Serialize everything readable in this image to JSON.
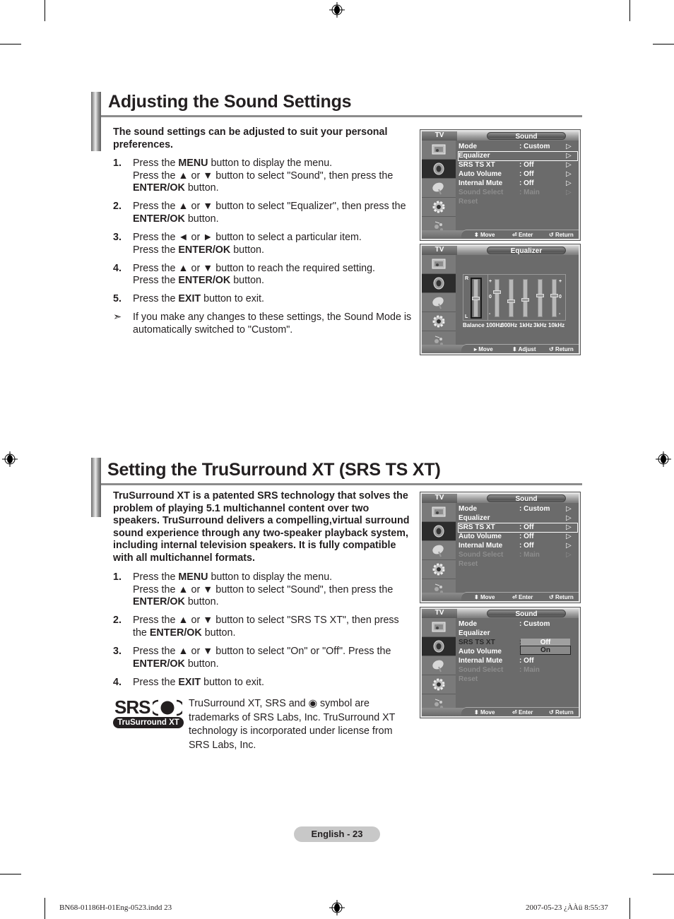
{
  "section1": {
    "title": "Adjusting the Sound Settings",
    "intro": "The sound settings can be adjusted to suit your personal preferences.",
    "steps": [
      {
        "num": "1.",
        "parts": [
          [
            "",
            "Press the "
          ],
          [
            "b",
            "MENU"
          ],
          [
            "",
            " button to display the menu."
          ],
          [
            "br",
            ""
          ],
          [
            "",
            "Press the ▲ or ▼ button to select \"Sound\", then press the "
          ],
          [
            "b",
            "ENTER/OK"
          ],
          [
            "",
            " button."
          ]
        ]
      },
      {
        "num": "2.",
        "parts": [
          [
            "",
            "Press the ▲ or ▼ button to select \"Equalizer\", then press the "
          ],
          [
            "b",
            "ENTER/OK"
          ],
          [
            "",
            " button."
          ]
        ]
      },
      {
        "num": "3.",
        "parts": [
          [
            "",
            "Press the ◄ or ► button to select a particular item."
          ],
          [
            "br",
            ""
          ],
          [
            "",
            "Press the "
          ],
          [
            "b",
            "ENTER/OK"
          ],
          [
            "",
            " button."
          ]
        ]
      },
      {
        "num": "4.",
        "parts": [
          [
            "",
            "Press the ▲ or ▼ button to reach the required setting."
          ],
          [
            "br",
            ""
          ],
          [
            "",
            "Press the "
          ],
          [
            "b",
            "ENTER/OK"
          ],
          [
            "",
            " button."
          ]
        ]
      },
      {
        "num": "5.",
        "parts": [
          [
            "",
            "Press the "
          ],
          [
            "b",
            "EXIT"
          ],
          [
            "",
            " button to exit."
          ]
        ]
      },
      {
        "num": "➣",
        "parts": [
          [
            "",
            "If you make any changes to these settings, the Sound Mode is automatically switched to \"Custom\"."
          ]
        ]
      }
    ]
  },
  "section2": {
    "title": "Setting the TruSurround XT (SRS TS XT)",
    "intro": "TruSurround XT is a patented SRS technology that solves the problem of playing 5.1 multichannel content over two speakers. TruSurround delivers a compelling,virtual surround sound experience through any two-speaker playback system, including internal television speakers. It is fully compatible with all multichannel formats.",
    "steps": [
      {
        "num": "1.",
        "parts": [
          [
            "",
            "Press the "
          ],
          [
            "b",
            "MENU"
          ],
          [
            "",
            " button to display the menu."
          ],
          [
            "br",
            ""
          ],
          [
            "",
            "Press the ▲ or ▼ button to select \"Sound\", then press the "
          ],
          [
            "b",
            "ENTER/OK"
          ],
          [
            "",
            " button."
          ]
        ]
      },
      {
        "num": "2.",
        "parts": [
          [
            "",
            "Press the ▲ or ▼ button to select \"SRS TS XT\", then press the "
          ],
          [
            "b",
            "ENTER/OK"
          ],
          [
            "",
            " button."
          ]
        ]
      },
      {
        "num": "3.",
        "parts": [
          [
            "",
            "Press the ▲ or ▼ button to select \"On\" or \"Off\". Press the "
          ],
          [
            "b",
            "ENTER/OK"
          ],
          [
            "",
            " button."
          ]
        ]
      },
      {
        "num": "4.",
        "parts": [
          [
            "",
            "Press the "
          ],
          [
            "b",
            "EXIT"
          ],
          [
            "",
            " button to exit."
          ]
        ]
      }
    ],
    "trademark": "TruSurround XT, SRS and ◉ symbol are trademarks of SRS Labs, Inc. TruSurround XT technology is incorporated under license from SRS Labs, Inc.",
    "logo": {
      "srs": "SRS",
      "sub": "TruSurround XT"
    }
  },
  "osd_common": {
    "tv_label": "TV",
    "sidebar_icons": [
      "picture-icon",
      "sound-icon",
      "channel-icon",
      "setup-icon",
      "input-icon"
    ],
    "selected_icon": 1
  },
  "osd1": {
    "title": "Sound",
    "rows": [
      {
        "label": "Mode",
        "value": ": Custom",
        "arrow": "▷",
        "state": "normal"
      },
      {
        "label": "Equalizer",
        "value": "",
        "arrow": "▷",
        "state": "highlight"
      },
      {
        "label": "SRS TS XT",
        "value": ": Off",
        "arrow": "▷",
        "state": "normal"
      },
      {
        "label": "Auto Volume",
        "value": ": Off",
        "arrow": "▷",
        "state": "normal"
      },
      {
        "label": "Internal Mute",
        "value": ": Off",
        "arrow": "▷",
        "state": "normal"
      },
      {
        "label": "Sound Select",
        "value": ": Main",
        "arrow": "▷",
        "state": "dim"
      },
      {
        "label": "Reset",
        "value": "",
        "arrow": "",
        "state": "dim"
      }
    ],
    "help": [
      {
        "icon": "⬍",
        "label": "Move"
      },
      {
        "icon": "⏎",
        "label": "Enter"
      },
      {
        "icon": "↺",
        "label": "Return"
      }
    ]
  },
  "osd2": {
    "title": "Equalizer",
    "balance": {
      "label": "Balance",
      "top": "R",
      "bottom": "L",
      "value": 0.5
    },
    "bands": [
      {
        "label": "100Hz",
        "value": 0.68
      },
      {
        "label": "300Hz",
        "value": 0.4
      },
      {
        "label": "1kHz",
        "value": 0.45
      },
      {
        "label": "3kHz",
        "value": 0.58
      },
      {
        "label": "10kHz",
        "value": 0.58
      }
    ],
    "marks": {
      "plus": "+",
      "zero": "0",
      "minus": "-"
    },
    "help": [
      {
        "icon": "▸",
        "label": "Move"
      },
      {
        "icon": "⬍",
        "label": "Adjust"
      },
      {
        "icon": "↺",
        "label": "Return"
      }
    ]
  },
  "osd3": {
    "title": "Sound",
    "rows": [
      {
        "label": "Mode",
        "value": ": Custom",
        "arrow": "▷",
        "state": "normal"
      },
      {
        "label": "Equalizer",
        "value": "",
        "arrow": "▷",
        "state": "normal"
      },
      {
        "label": "SRS TS XT",
        "value": ": Off",
        "arrow": "▷",
        "state": "highlight"
      },
      {
        "label": "Auto Volume",
        "value": ": Off",
        "arrow": "▷",
        "state": "normal"
      },
      {
        "label": "Internal Mute",
        "value": ": Off",
        "arrow": "▷",
        "state": "normal"
      },
      {
        "label": "Sound Select",
        "value": ": Main",
        "arrow": "▷",
        "state": "dim"
      },
      {
        "label": "Reset",
        "value": "",
        "arrow": "",
        "state": "dim"
      }
    ],
    "help": [
      {
        "icon": "⬍",
        "label": "Move"
      },
      {
        "icon": "⏎",
        "label": "Enter"
      },
      {
        "icon": "↺",
        "label": "Return"
      }
    ]
  },
  "osd4": {
    "title": "Sound",
    "rows": [
      {
        "label": "Mode",
        "value": ": Custom",
        "arrow": "",
        "state": "normal"
      },
      {
        "label": "Equalizer",
        "value": "",
        "arrow": "",
        "state": "normal"
      },
      {
        "label": "SRS TS XT",
        "value": ":",
        "arrow": "",
        "state": "dark"
      },
      {
        "label": "Auto Volume",
        "value": ":",
        "arrow": "",
        "state": "normal"
      },
      {
        "label": "Internal Mute",
        "value": ": Off",
        "arrow": "",
        "state": "normal"
      },
      {
        "label": "Sound Select",
        "value": ": Main",
        "arrow": "",
        "state": "dim"
      },
      {
        "label": "Reset",
        "value": "",
        "arrow": "",
        "state": "dim"
      }
    ],
    "popup": {
      "options": [
        "Off",
        "On"
      ],
      "selected": "On"
    },
    "help": [
      {
        "icon": "⬍",
        "label": "Move"
      },
      {
        "icon": "⏎",
        "label": "Enter"
      },
      {
        "icon": "↺",
        "label": "Return"
      }
    ]
  },
  "footer": {
    "page_label": "English - 23",
    "slug_left": "BN68-01186H-01Eng-0523.indd   23",
    "slug_right": "2007-05-23   ¿ÀÀü 8:55:37"
  }
}
